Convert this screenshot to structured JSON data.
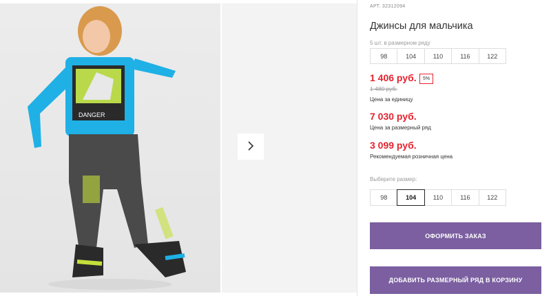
{
  "product": {
    "sku": "АРТ. 32312094",
    "title": "Джинсы для мальчика",
    "size_row_label": "5 шт. в размерном ряду",
    "size_row": [
      "98",
      "104",
      "110",
      "116",
      "122"
    ],
    "price_unit": "1 406 руб.",
    "discount_badge": "5%",
    "old_price": "1 480 руб.",
    "price_unit_caption": "Цена за единицу",
    "price_row": "7 030 руб.",
    "price_row_caption": "Цена за размерный ряд",
    "price_retail": "3 099 руб.",
    "price_retail_caption": "Рекомендуемая розничная цена",
    "choose_size_label": "Выберите размер:",
    "sizes": [
      "98",
      "104",
      "110",
      "116",
      "122"
    ],
    "selected_size": "104"
  },
  "actions": {
    "checkout_label": "ОФОРМИТЬ ЗАКАЗ",
    "add_row_label": "ДОБАВИТЬ РАЗМЕРНЫЙ РЯД В КОРЗИНУ"
  },
  "colors": {
    "accent": "#7b5fa0",
    "price": "#e3232e"
  },
  "icons": {
    "gallery_next": "chevron-right-icon"
  }
}
